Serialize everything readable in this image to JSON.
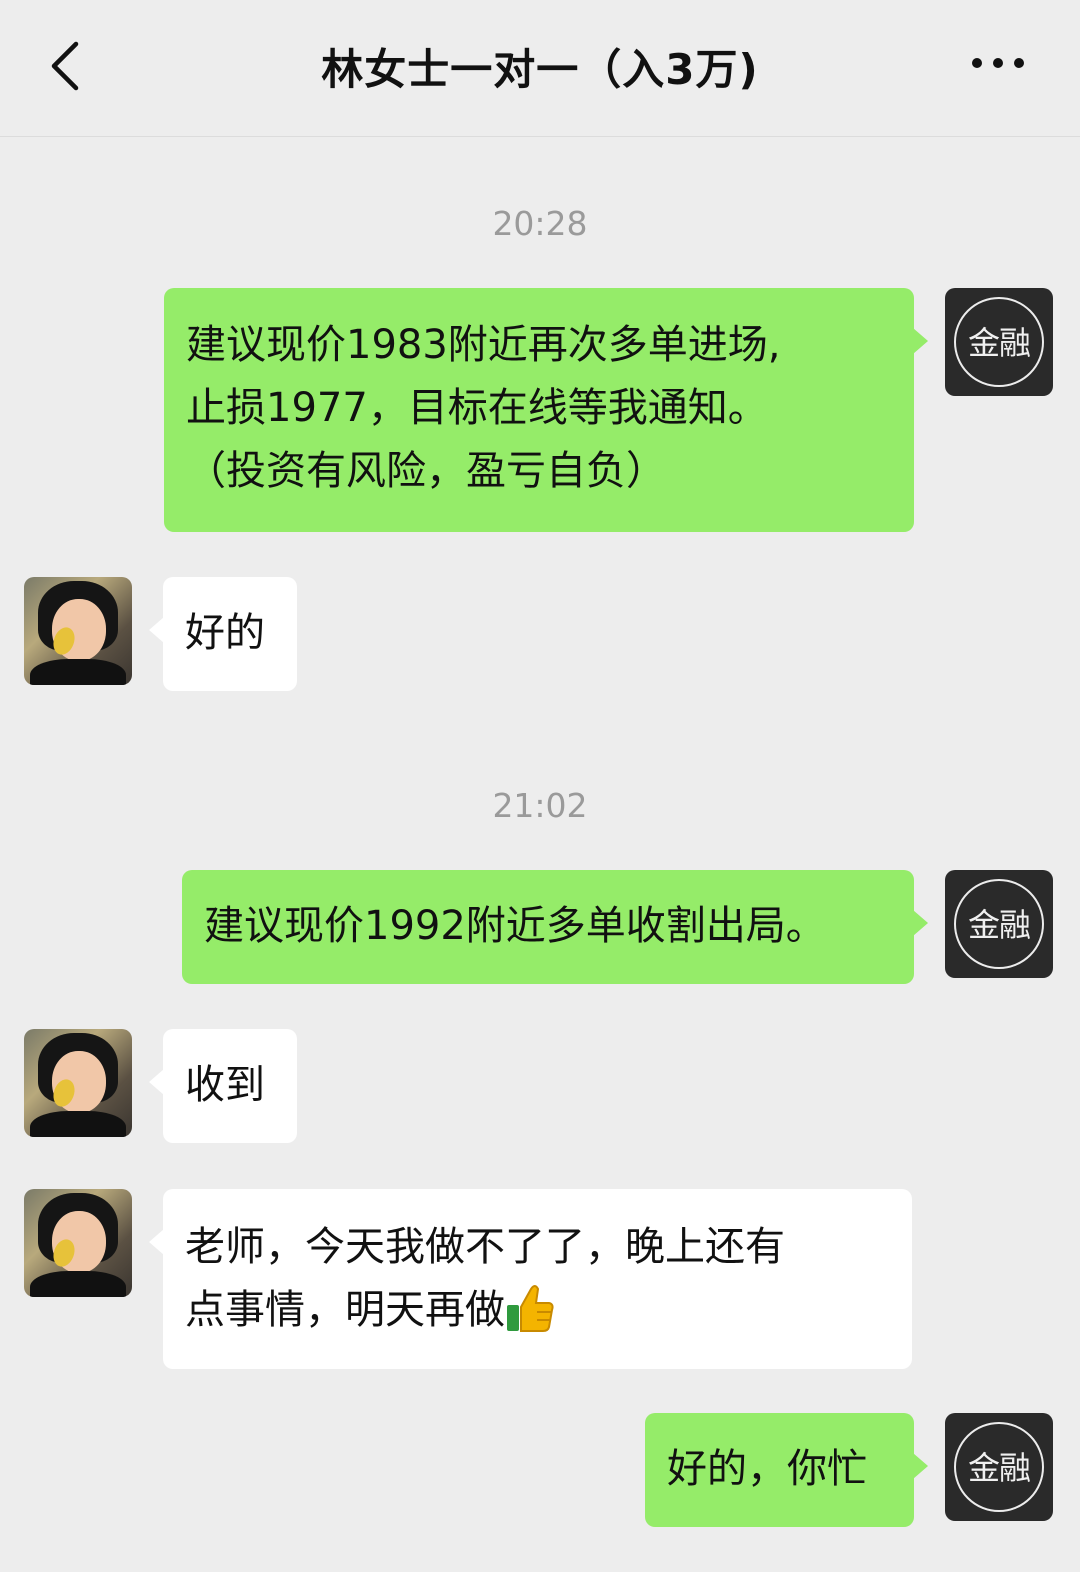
{
  "header": {
    "title": "林女士一对一（入3万)",
    "back_icon": "chevron-left-icon",
    "more_icon": "more-dots-icon"
  },
  "self_avatar_label": "金融",
  "messages": [
    {
      "type": "time",
      "text": "20:28"
    },
    {
      "type": "sent",
      "lines": [
        "建议现价1983附近再次多单进场,",
        "止损1977，目标在线等我通知。",
        "（投资有风险，盈亏自负）"
      ]
    },
    {
      "type": "received",
      "lines": [
        "好的"
      ]
    },
    {
      "type": "time",
      "text": "21:02"
    },
    {
      "type": "sent",
      "lines": [
        "建议现价1992附近多单收割出局。"
      ]
    },
    {
      "type": "received",
      "lines": [
        "收到"
      ]
    },
    {
      "type": "received",
      "lines": [
        "老师，今天我做不了了，晚上还有",
        "点事情，明天再做"
      ],
      "emoji": "thumbs-up-icon"
    },
    {
      "type": "sent",
      "lines": [
        "好的，你忙"
      ]
    }
  ]
}
